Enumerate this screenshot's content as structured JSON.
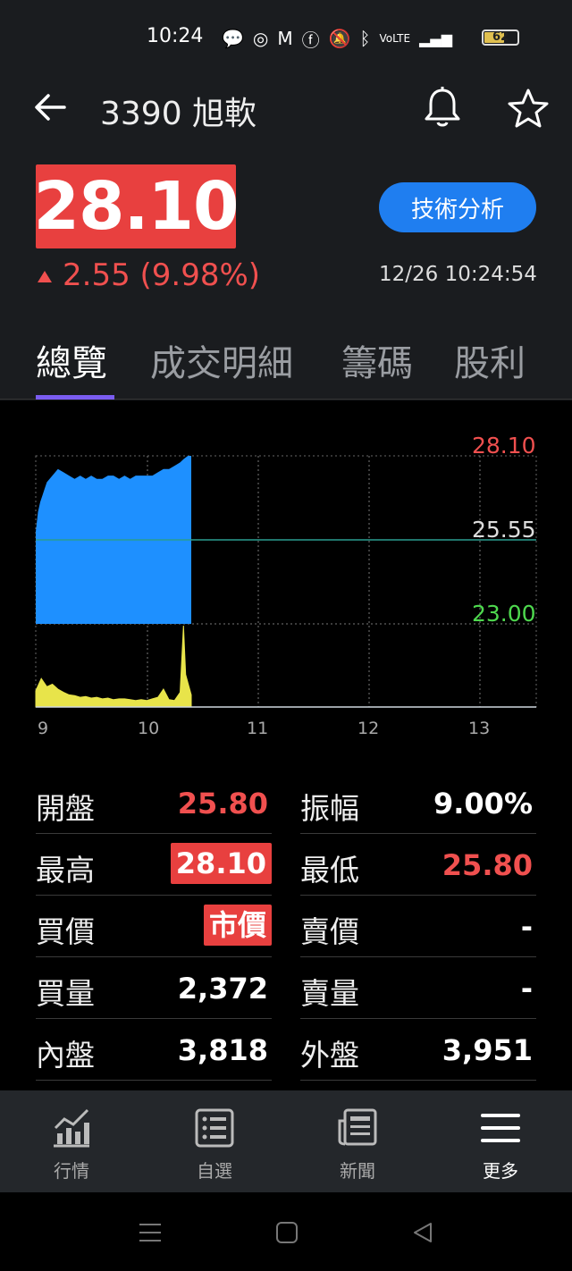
{
  "status_bar": {
    "time": "10:24",
    "battery": "62",
    "battery_level": 0.62
  },
  "header": {
    "title": "3390 旭軟",
    "icons": [
      "back-arrow-icon",
      "bell-icon",
      "star-icon"
    ]
  },
  "quote": {
    "price": "28.10",
    "change": "2.55 (9.98%)",
    "timestamp": "12/26 10:24:54",
    "tech_analysis_label": "技術分析",
    "up_color": "#f0504f"
  },
  "tabs": [
    {
      "label": "總覽",
      "active": true
    },
    {
      "label": "成交明細",
      "active": false
    },
    {
      "label": "籌碼",
      "active": false
    },
    {
      "label": "股利",
      "active": false
    }
  ],
  "chart_data": {
    "type": "area",
    "price_labels": {
      "high": "28.10",
      "reference": "25.55",
      "low": "23.00"
    },
    "ylim": [
      23.0,
      28.1
    ],
    "x_ticks": [
      "9",
      "10",
      "11",
      "12",
      "13"
    ],
    "xlim": [
      9.0,
      13.5
    ],
    "price_series": {
      "x": [
        9.0,
        9.02,
        9.04,
        9.06,
        9.08,
        9.1,
        9.15,
        9.2,
        9.25,
        9.3,
        9.35,
        9.4,
        9.45,
        9.5,
        9.55,
        9.6,
        9.65,
        9.7,
        9.75,
        9.8,
        9.85,
        9.9,
        9.95,
        10.0,
        10.05,
        10.1,
        10.15,
        10.2,
        10.25,
        10.3,
        10.33,
        10.37,
        10.4
      ],
      "y": [
        25.8,
        26.4,
        26.7,
        26.9,
        27.1,
        27.3,
        27.5,
        27.7,
        27.6,
        27.5,
        27.4,
        27.5,
        27.4,
        27.5,
        27.4,
        27.4,
        27.5,
        27.5,
        27.4,
        27.5,
        27.4,
        27.5,
        27.5,
        27.5,
        27.5,
        27.6,
        27.7,
        27.7,
        27.8,
        27.9,
        28.0,
        28.1,
        28.1
      ]
    },
    "volume_series": {
      "x": [
        9.0,
        9.05,
        9.1,
        9.15,
        9.2,
        9.25,
        9.3,
        9.35,
        9.4,
        9.45,
        9.5,
        9.55,
        9.6,
        9.65,
        9.7,
        9.75,
        9.8,
        9.85,
        9.9,
        9.95,
        10.0,
        10.05,
        10.1,
        10.15,
        10.2,
        10.25,
        10.3,
        10.33,
        10.35,
        10.37,
        10.4
      ],
      "y": [
        20,
        35,
        25,
        28,
        22,
        18,
        15,
        14,
        12,
        13,
        11,
        12,
        10,
        11,
        9,
        10,
        10,
        9,
        8,
        9,
        8,
        10,
        12,
        22,
        9,
        8,
        18,
        100,
        40,
        30,
        15
      ]
    },
    "price_color": "#1e90ff",
    "volume_color": "#e8e44a",
    "reference_line_color": "#2a9d8f"
  },
  "stats": {
    "left": [
      {
        "label": "開盤",
        "value": "25.80",
        "style": "red"
      },
      {
        "label": "最高",
        "value": "28.10",
        "style": "boxed"
      },
      {
        "label": "買價",
        "value": "市價",
        "style": "boxed"
      },
      {
        "label": "買量",
        "value": "2,372",
        "style": "white"
      },
      {
        "label": "內盤",
        "value": "3,818",
        "style": "white"
      }
    ],
    "right": [
      {
        "label": "振幅",
        "value": "9.00%",
        "style": "white"
      },
      {
        "label": "最低",
        "value": "25.80",
        "style": "red"
      },
      {
        "label": "賣價",
        "value": "-",
        "style": "white"
      },
      {
        "label": "賣量",
        "value": "-",
        "style": "white"
      },
      {
        "label": "外盤",
        "value": "3,951",
        "style": "white"
      }
    ]
  },
  "bottom_nav": [
    {
      "label": "行情",
      "icon": "market-chart-icon",
      "active": false
    },
    {
      "label": "自選",
      "icon": "watchlist-icon",
      "active": false
    },
    {
      "label": "新聞",
      "icon": "news-icon",
      "active": false
    },
    {
      "label": "更多",
      "icon": "menu-icon",
      "active": true
    }
  ]
}
